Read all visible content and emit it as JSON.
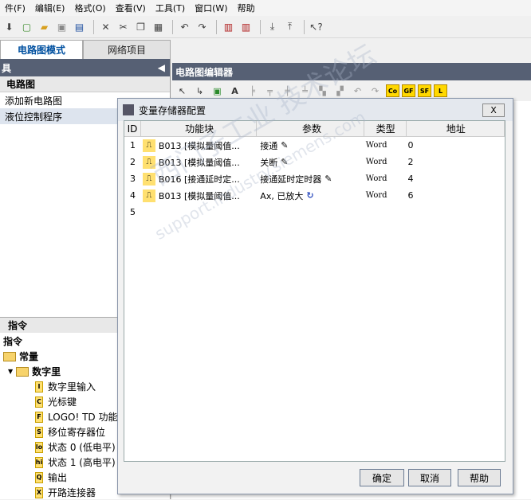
{
  "menu": [
    "件(F)",
    "编辑(E)",
    "格式(O)",
    "查看(V)",
    "工具(T)",
    "窗口(W)",
    "帮助"
  ],
  "tabs": {
    "circuit_mode": "电路图模式",
    "network_project": "网络项目"
  },
  "left_panel": {
    "title": "具",
    "section_title": "电路图",
    "items": [
      "添加新电路图",
      "液位控制程序"
    ],
    "instructions_title": "指令",
    "instructions_label": "指令",
    "tree": {
      "constants": "常量",
      "digital": "数字里",
      "items": [
        {
          "badge": "I",
          "label": "数字里输入"
        },
        {
          "badge": "C",
          "label": "光标键"
        },
        {
          "badge": "F",
          "label": "LOGO! TD 功能键"
        },
        {
          "badge": "S",
          "label": "移位寄存器位"
        },
        {
          "badge": "lo",
          "label": "状态 0 (低电平)"
        },
        {
          "badge": "hi",
          "label": "状态 1 (高电平)"
        },
        {
          "badge": "Q",
          "label": "输出"
        },
        {
          "badge": "X",
          "label": "开路连接器"
        }
      ]
    }
  },
  "editor": {
    "title": "电路图编辑器",
    "tool_labels": [
      "Co",
      "GF",
      "SF",
      "L"
    ]
  },
  "dialog": {
    "title": "变量存储器配置",
    "close": "X",
    "columns": [
      "ID",
      "功能块",
      "参数",
      "类型",
      "地址"
    ],
    "rows": [
      {
        "id": "1",
        "block": "B013 [模拟量阈值...",
        "param": "接通",
        "type": "Word",
        "address": "0",
        "icon": "edit-icon"
      },
      {
        "id": "2",
        "block": "B013 [模拟量阈值...",
        "param": "关断",
        "type": "Word",
        "address": "2",
        "icon": "edit-icon"
      },
      {
        "id": "3",
        "block": "B016 [接通延时定...",
        "param": "接通延时定时器",
        "type": "Word",
        "address": "4",
        "icon": "edit-icon"
      },
      {
        "id": "4",
        "block": "B013 [模拟量阈值...",
        "param": "Ax, 已放大",
        "type": "Word",
        "address": "6",
        "icon": "refresh-icon"
      },
      {
        "id": "5",
        "block": "",
        "param": "",
        "type": "",
        "address": "",
        "icon": ""
      }
    ],
    "buttons": {
      "ok": "确定",
      "cancel": "取消",
      "help": "帮助"
    }
  },
  "watermark": {
    "line1": "西门子工业  技术论坛",
    "line2": "support.industry.siemens.com"
  }
}
